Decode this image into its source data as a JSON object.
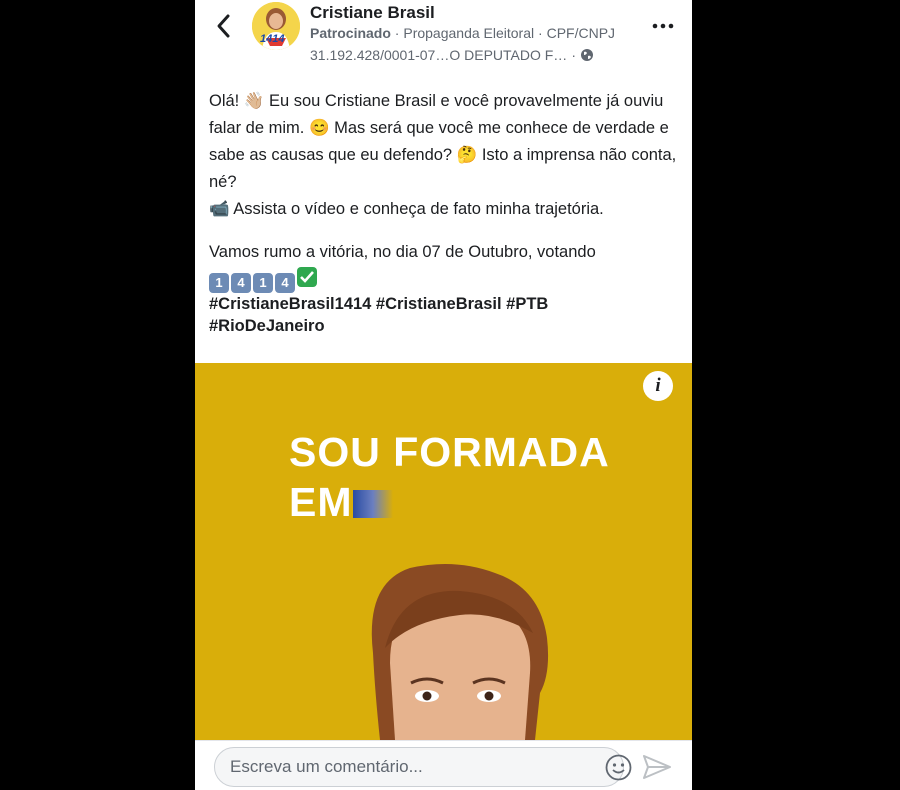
{
  "page": {
    "name": "Cristiane Brasil",
    "sponsored": "Patrocinado",
    "meta_sep1": "·",
    "category": "Propaganda Eleitoral",
    "meta_sep2": "·",
    "tax_label": "CPF/CNPJ",
    "tax_line": "31.192.428/0001-07…O DEPUTADO F…",
    "meta_sep3": "·",
    "avatar_text": "1414",
    "globe_icon": "globe-icon"
  },
  "post": {
    "line1": "Olá! 👋🏼 Eu sou Cristiane Brasil e você provavelmente já ouviu falar de mim. 😊 Mas será que você me conhece de verdade e sabe as causas que eu defendo? 🤔 Isto a imprensa não conta, né?",
    "line2": "📹 Assista o vídeo e conheça de fato minha trajetória.",
    "line3": "Vamos rumo a vitória, no dia 07 de Outubro, votando",
    "keycaps": [
      "1",
      "4",
      "1",
      "4"
    ],
    "hashtags_line1": "#CristianeBrasil1414 #CristianeBrasil #PTB",
    "hashtags_line2": "#RioDeJaneiro"
  },
  "video": {
    "info": "i",
    "overlay_line1": "SOU FORMADA",
    "overlay_line2": "EM"
  },
  "comment": {
    "placeholder": "Escreva um comentário..."
  },
  "colors": {
    "video_bg": "#d9ae0a",
    "text": "#1c1e21",
    "muted": "#606770"
  }
}
